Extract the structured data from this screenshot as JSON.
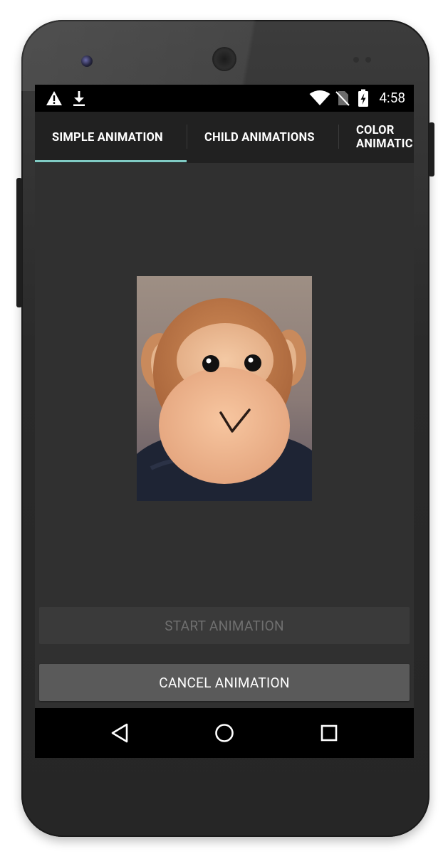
{
  "status_bar": {
    "icons": [
      "warning-icon",
      "download-icon",
      "wifi-icon",
      "no-sim-icon",
      "battery-charging-icon"
    ],
    "time": "4:58"
  },
  "tabs": [
    {
      "label": "SIMPLE ANIMATION",
      "selected": true
    },
    {
      "label": "CHILD ANIMATIONS",
      "selected": false
    },
    {
      "label_line1": "COLOR",
      "label_line2": "ANIMATIC",
      "selected": false
    }
  ],
  "colors": {
    "tab_indicator": "#80cbc4",
    "background": "#303030",
    "tabbar": "#212121"
  },
  "image": {
    "icon": "monkey-plush-photo"
  },
  "buttons": {
    "start": {
      "label": "START ANIMATION",
      "enabled": false
    },
    "cancel": {
      "label": "CANCEL ANIMATION",
      "enabled": true
    }
  },
  "nav_bar": {
    "icons": [
      "back-icon",
      "home-icon",
      "recents-icon"
    ]
  }
}
